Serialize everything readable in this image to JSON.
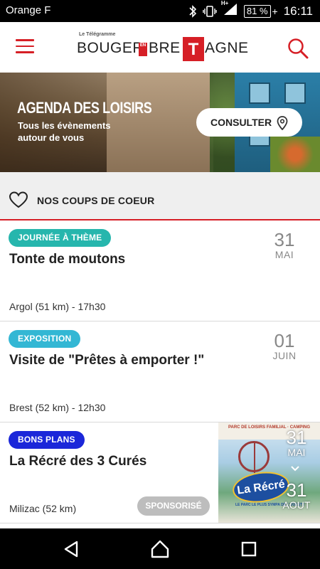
{
  "status_bar": {
    "carrier": "Orange F",
    "network": "H+",
    "battery": "81 %",
    "time": "16:11"
  },
  "header": {
    "logo_small": "Le Télégramme",
    "logo_part1": "BOUGER",
    "logo_en": "EN",
    "logo_part2": "BRE",
    "logo_t": "T",
    "logo_part3": "AGNE"
  },
  "hero": {
    "title": "AGENDA DES LOISIRS",
    "subtitle": "Tous les évènements autour de vous",
    "button_label": "CONSULTER"
  },
  "section": {
    "title": "NOS COUPS DE COEUR"
  },
  "colors": {
    "brand_red": "#d61f26",
    "teal_badge": "#26b6ad",
    "cyan_badge": "#33b7d4",
    "blue_badge": "#1b27d9",
    "sponsor_grey": "#bdbdbd"
  },
  "events": [
    {
      "badge": "JOURNÉE À THÈME",
      "title": "Tonte de moutons",
      "meta": "Argol (51 km) - 17h30",
      "day": "31",
      "month": "MAI"
    },
    {
      "badge": "EXPOSITION",
      "title": "Visite de  \"Prêtes à emporter !\"",
      "meta": "Brest (52 km) - 12h30",
      "day": "01",
      "month": "JUIN"
    },
    {
      "badge": "BONS PLANS",
      "title": "La Récré des 3 Curés",
      "meta": "Milizac (52 km)",
      "start_day": "31",
      "start_month": "MAI",
      "end_day": "31",
      "end_month": "AOUT",
      "sponsor_label": "SPONSORISÉ",
      "image_banner": "PARC DE LOISIRS FAMILIAL · CAMPING",
      "image_brand": "La Récré",
      "image_tagline": "LE PARC LE PLUS SYMPA DE L'OUEST !"
    }
  ],
  "nav": {
    "back_icon": "back-triangle-icon",
    "home_icon": "home-icon",
    "recents_icon": "recents-square-icon"
  }
}
